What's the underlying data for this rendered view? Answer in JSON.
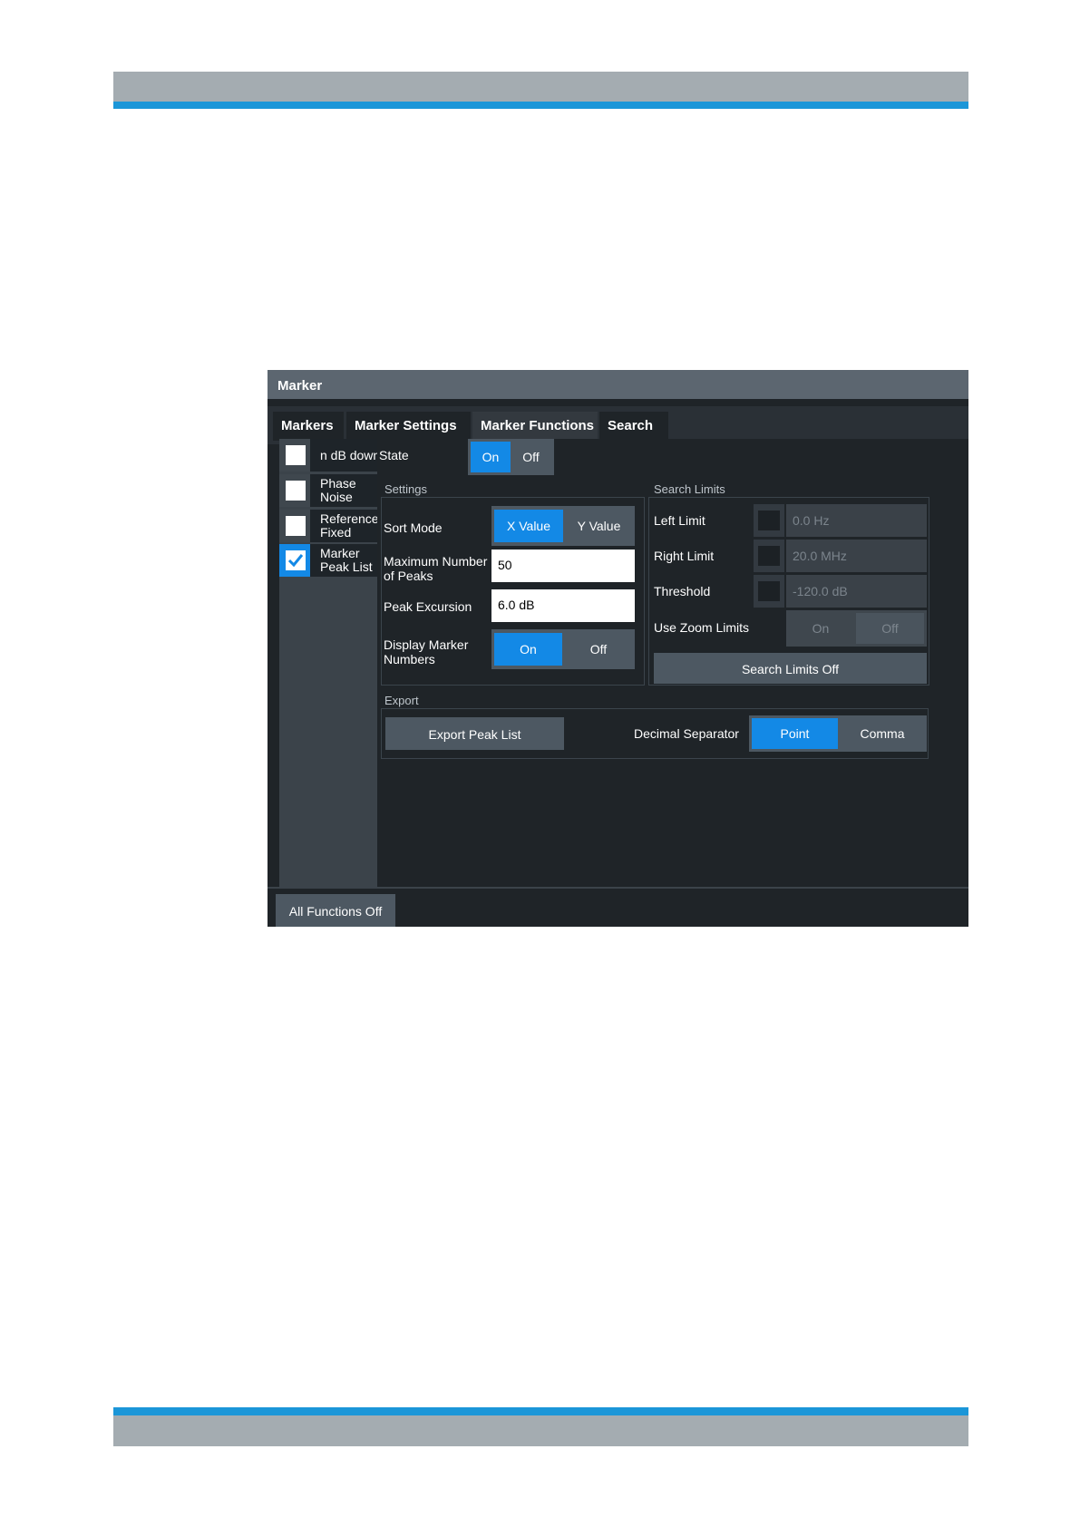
{
  "dialog": {
    "title": "Marker"
  },
  "tabs": [
    {
      "label": "Markers"
    },
    {
      "label": "Marker Settings"
    },
    {
      "label": "Marker Functions"
    },
    {
      "label": "Search"
    }
  ],
  "functions": [
    {
      "line1": "n dB down",
      "line2": "",
      "checked": false
    },
    {
      "line1": "Phase",
      "line2": "Noise",
      "checked": false
    },
    {
      "line1": "Reference",
      "line2": "Fixed",
      "checked": false
    },
    {
      "line1": "Marker",
      "line2": "Peak List",
      "checked": true
    }
  ],
  "state": {
    "label": "State",
    "on": "On",
    "off": "Off",
    "selected": "On"
  },
  "settings": {
    "group_label": "Settings",
    "sort_mode": {
      "label": "Sort Mode",
      "option1": "X Value",
      "option2": "Y Value",
      "selected": "X Value"
    },
    "max_peaks": {
      "label_line1": "Maximum Number",
      "label_line2": "of Peaks",
      "value": "50"
    },
    "peak_excursion": {
      "label": "Peak Excursion",
      "value": "6.0 dB"
    },
    "display_numbers": {
      "label_line1": "Display Marker",
      "label_line2": "Numbers",
      "on": "On",
      "off": "Off",
      "selected": "On"
    }
  },
  "search_limits": {
    "group_label": "Search Limits",
    "left_limit": {
      "label": "Left Limit",
      "value": "0.0 Hz",
      "checked": false
    },
    "right_limit": {
      "label": "Right Limit",
      "value": "20.0 MHz",
      "checked": false
    },
    "threshold": {
      "label": "Threshold",
      "value": "-120.0 dB",
      "checked": false
    },
    "zoom_limits": {
      "label": "Use Zoom Limits",
      "on": "On",
      "off": "Off",
      "selected": "Off"
    },
    "off_button": "Search Limits Off"
  },
  "export": {
    "group_label": "Export",
    "button": "Export Peak List",
    "decimal_label": "Decimal Separator",
    "point": "Point",
    "comma": "Comma",
    "selected": "Point"
  },
  "all_functions_off": "All Functions Off",
  "colors": {
    "accent": "#1389e6",
    "brand_band": "#1b96d8",
    "band_gray": "#a4acb1"
  }
}
